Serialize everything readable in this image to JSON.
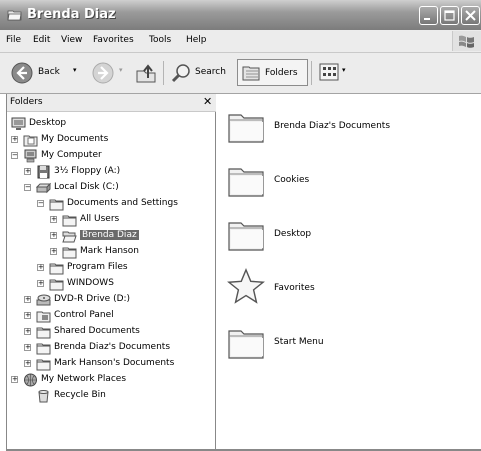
{
  "window": {
    "title": "Brenda Diaz"
  },
  "menu": {
    "items": [
      {
        "label": "File"
      },
      {
        "label": "Edit"
      },
      {
        "label": "View"
      },
      {
        "label": "Favorites"
      },
      {
        "label": "Tools"
      },
      {
        "label": "Help"
      }
    ]
  },
  "toolbar": {
    "back_label": "Back",
    "search_label": "Search",
    "folders_label": "Folders"
  },
  "folders_pane": {
    "title": "Folders",
    "tree": [
      {
        "label": "Desktop",
        "expander": "",
        "icon": "desktop-icon",
        "selected": false
      },
      {
        "label": "My Documents",
        "expander": "+",
        "icon": "my-documents-icon",
        "selected": false
      },
      {
        "label": "My Computer",
        "expander": "−",
        "icon": "my-computer-icon",
        "selected": false
      },
      {
        "label": "3½ Floppy (A:)",
        "expander": "+",
        "icon": "floppy-icon",
        "selected": false
      },
      {
        "label": "Local Disk (C:)",
        "expander": "−",
        "icon": "hard-drive-icon",
        "selected": false
      },
      {
        "label": "Documents and Settings",
        "expander": "−",
        "icon": "folder-icon",
        "selected": false
      },
      {
        "label": "All Users",
        "expander": "+",
        "icon": "folder-icon",
        "selected": false
      },
      {
        "label": "Brenda Diaz",
        "expander": "+",
        "icon": "folder-open-icon",
        "selected": true
      },
      {
        "label": "Mark Hanson",
        "expander": "+",
        "icon": "folder-icon",
        "selected": false
      },
      {
        "label": "Program Files",
        "expander": "+",
        "icon": "folder-icon",
        "selected": false
      },
      {
        "label": "WINDOWS",
        "expander": "+",
        "icon": "folder-icon",
        "selected": false
      },
      {
        "label": "DVD-R Drive (D:)",
        "expander": "+",
        "icon": "dvd-drive-icon",
        "selected": false
      },
      {
        "label": "Control Panel",
        "expander": "+",
        "icon": "control-panel-icon",
        "selected": false
      },
      {
        "label": "Shared Documents",
        "expander": "+",
        "icon": "folder-icon",
        "selected": false
      },
      {
        "label": "Brenda Diaz's Documents",
        "expander": "+",
        "icon": "folder-icon",
        "selected": false
      },
      {
        "label": "Mark Hanson's Documents",
        "expander": "+",
        "icon": "folder-icon",
        "selected": false
      },
      {
        "label": "My Network Places",
        "expander": "+",
        "icon": "network-places-icon",
        "selected": false
      },
      {
        "label": "Recycle Bin",
        "expander": "",
        "icon": "recycle-bin-icon",
        "selected": false
      }
    ]
  },
  "content": {
    "items": [
      {
        "label": "Brenda Diaz's Documents",
        "icon": "folder-icon"
      },
      {
        "label": "Cookies",
        "icon": "folder-icon"
      },
      {
        "label": "Desktop",
        "icon": "folder-icon"
      },
      {
        "label": "Favorites",
        "icon": "star-icon"
      },
      {
        "label": "Start Menu",
        "icon": "folder-icon"
      }
    ]
  }
}
